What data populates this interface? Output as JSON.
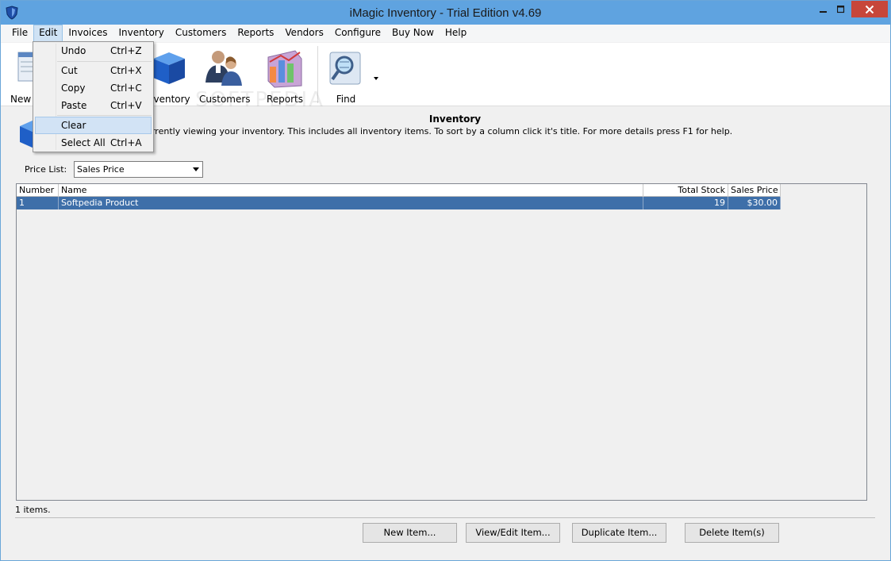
{
  "window": {
    "title": "iMagic Inventory - Trial Edition v4.69",
    "accent": "#5fa3e0"
  },
  "menubar": {
    "items": [
      "File",
      "Edit",
      "Invoices",
      "Inventory",
      "Customers",
      "Reports",
      "Vendors",
      "Configure",
      "Buy Now",
      "Help"
    ]
  },
  "toolbar": {
    "buttons": [
      "New",
      "Inventory",
      "Customers",
      "Reports",
      "Find"
    ]
  },
  "edit_menu": {
    "items": [
      {
        "label": "Undo",
        "shortcut": "Ctrl+Z"
      },
      {
        "label": "Cut",
        "shortcut": "Ctrl+X"
      },
      {
        "label": "Copy",
        "shortcut": "Ctrl+C"
      },
      {
        "label": "Paste",
        "shortcut": "Ctrl+V"
      },
      {
        "label": "Clear",
        "shortcut": ""
      },
      {
        "label": "Select All",
        "shortcut": "Ctrl+A"
      }
    ]
  },
  "main": {
    "title": "Inventory",
    "description": "urrently viewing your inventory. This includes all inventory items. To sort by a column click it's title. For more details press F1 for help.",
    "price_list_label": "Price List:",
    "price_list_value": "Sales Price",
    "columns": [
      "Number",
      "Name",
      "Total Stock",
      "Sales Price"
    ],
    "rows": [
      {
        "number": "1",
        "name": "Softpedia Product",
        "total_stock": "19",
        "sales_price": "$30.00"
      }
    ],
    "count_text": "1 items."
  },
  "buttons": {
    "new_item": "New Item...",
    "view_edit_item": "View/Edit Item...",
    "duplicate_item": "Duplicate Item...",
    "delete_items": "Delete Item(s)"
  },
  "watermark": "SOFTPEDIA"
}
